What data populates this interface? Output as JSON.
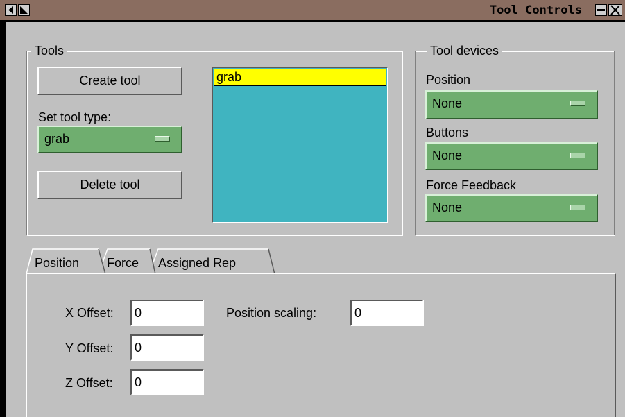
{
  "window": {
    "title": "Tool Controls"
  },
  "tools_group": {
    "legend": "Tools",
    "create_button": "Create tool",
    "set_type_label": "Set tool type:",
    "tool_type_value": "grab",
    "delete_button": "Delete tool",
    "list_items": [
      "grab"
    ]
  },
  "devices_group": {
    "legend": "Tool devices",
    "position_label": "Position",
    "position_value": "None",
    "buttons_label": "Buttons",
    "buttons_value": "None",
    "force_label": "Force Feedback",
    "force_value": "None"
  },
  "tabs": [
    {
      "label": "Position"
    },
    {
      "label": "Force"
    },
    {
      "label": "Assigned Rep"
    }
  ],
  "position_tab": {
    "x_label": "X Offset:",
    "x_value": "0",
    "y_label": "Y Offset:",
    "y_value": "0",
    "z_label": "Z Offset:",
    "z_value": "0",
    "scaling_label": "Position scaling:",
    "scaling_value": "0"
  },
  "colors": {
    "titlebar": "#8a6d60",
    "option_menu": "#6fae6f",
    "listbox": "#40b4c0",
    "selected_item": "#ffff00"
  }
}
